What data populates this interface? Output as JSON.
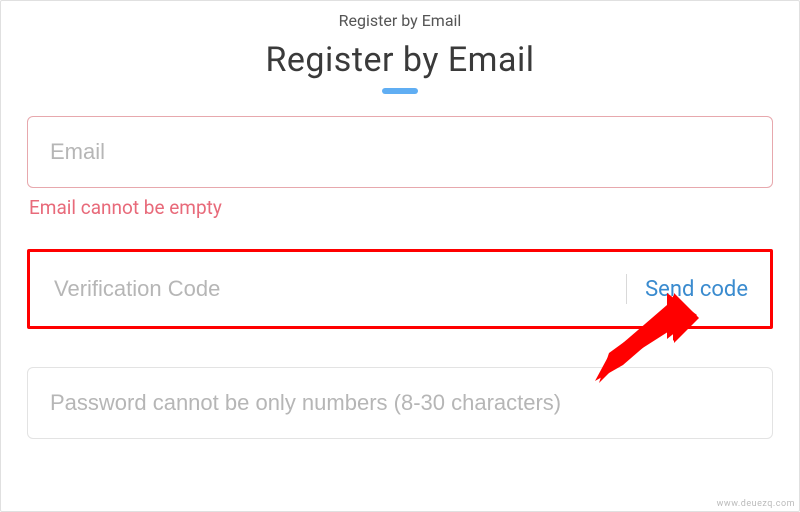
{
  "topbar": {
    "title": "Register by Email"
  },
  "heading": "Register by Email",
  "fields": {
    "email": {
      "placeholder": "Email",
      "value": "",
      "error": "Email cannot be empty"
    },
    "code": {
      "placeholder": "Verification Code",
      "value": "",
      "send_label": "Send code"
    },
    "password": {
      "placeholder": "Password cannot be only numbers (8-30 characters)",
      "value": ""
    }
  },
  "accent_color": "#60aef3",
  "highlight_color": "#ff0000",
  "watermark": "www.deuezq.com"
}
